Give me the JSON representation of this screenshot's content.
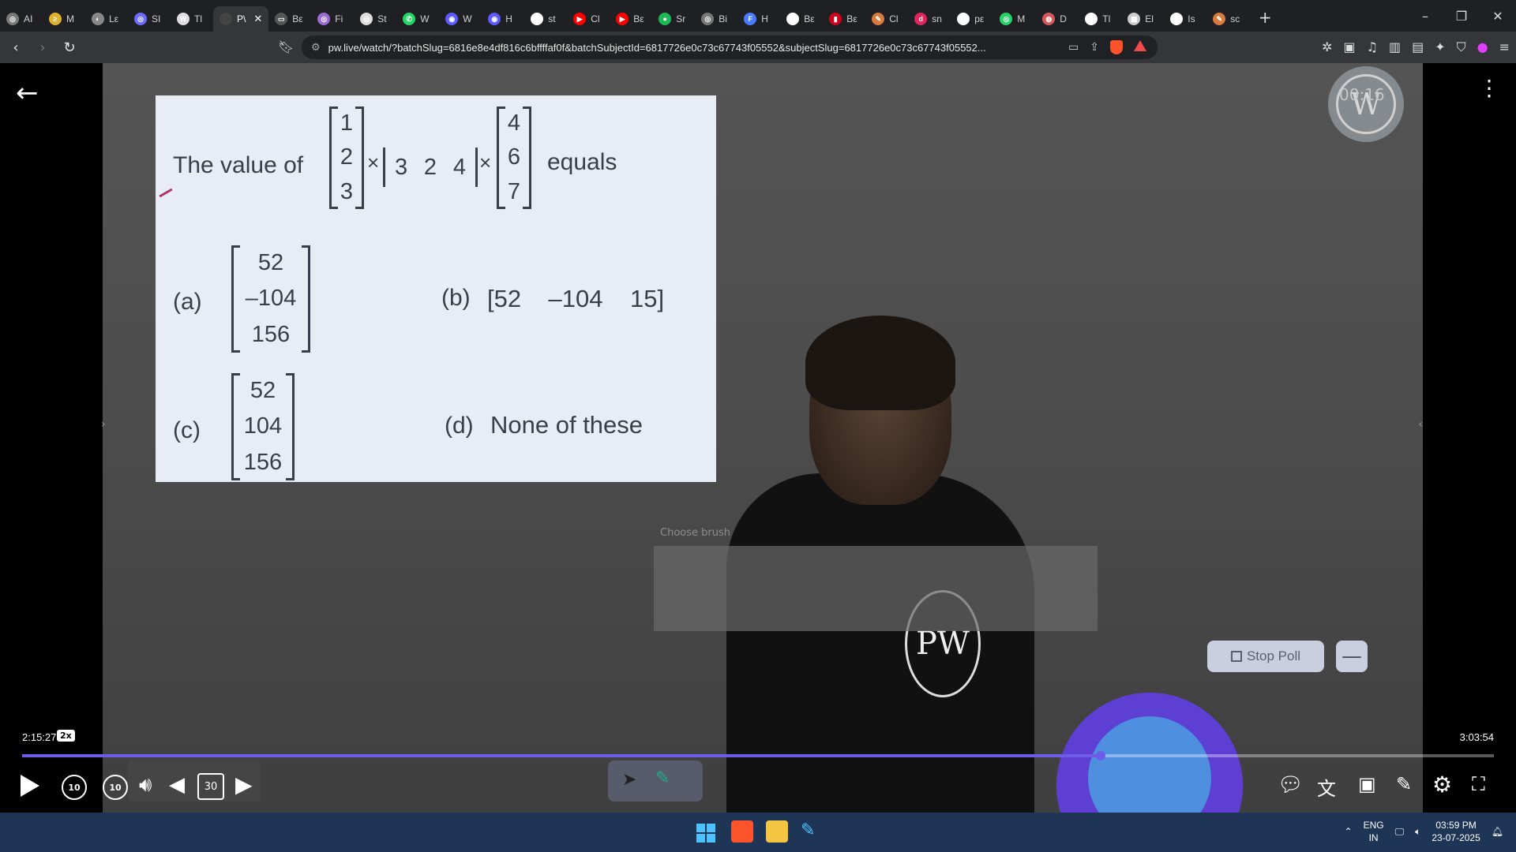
{
  "browser": {
    "tabs": [
      {
        "label": "AI",
        "color": "#7a7a7a",
        "glyph": "◎"
      },
      {
        "label": "M",
        "color": "#e0b030",
        "glyph": "≥"
      },
      {
        "label": "Lε",
        "color": "#888",
        "glyph": "◐"
      },
      {
        "label": "SI",
        "color": "#6b6bff",
        "glyph": "◎"
      },
      {
        "label": "Tl",
        "color": "#ddd",
        "glyph": "W"
      },
      {
        "label": "P\\",
        "color": "#444",
        "glyph": "",
        "active": true
      },
      {
        "label": "Bε",
        "color": "#555",
        "glyph": "▭"
      },
      {
        "label": "Fi",
        "color": "#9b6bd6",
        "glyph": "◎"
      },
      {
        "label": "St",
        "color": "#ddd",
        "glyph": "◎"
      },
      {
        "label": "W",
        "color": "#25d366",
        "glyph": "✆"
      },
      {
        "label": "W",
        "color": "#5b5bff",
        "glyph": "◉"
      },
      {
        "label": "H",
        "color": "#5b5bff",
        "glyph": "◉"
      },
      {
        "label": "st",
        "color": "#fff",
        "glyph": "G"
      },
      {
        "label": "Cl",
        "color": "#ff0000",
        "glyph": "▶"
      },
      {
        "label": "Bε",
        "color": "#ff0000",
        "glyph": "▶"
      },
      {
        "label": "Sr",
        "color": "#1db954",
        "glyph": "●"
      },
      {
        "label": "Bi",
        "color": "#777",
        "glyph": "◎"
      },
      {
        "label": "H",
        "color": "#4a7bff",
        "glyph": "F"
      },
      {
        "label": "Bε",
        "color": "#fff",
        "glyph": "G"
      },
      {
        "label": "Bε",
        "color": "#d0021b",
        "glyph": "▮"
      },
      {
        "label": "Cl",
        "color": "#d97a3a",
        "glyph": "✎"
      },
      {
        "label": "sn",
        "color": "#e0245e",
        "glyph": "d"
      },
      {
        "label": "pε",
        "color": "#fff",
        "glyph": "G"
      },
      {
        "label": "M",
        "color": "#25d366",
        "glyph": "◎"
      },
      {
        "label": "D",
        "color": "#d45a5a",
        "glyph": "◍"
      },
      {
        "label": "Tl",
        "color": "#fff",
        "glyph": "G"
      },
      {
        "label": "El",
        "color": "#ccc",
        "glyph": "▦"
      },
      {
        "label": "Is",
        "color": "#fff",
        "glyph": "G"
      },
      {
        "label": "sc",
        "color": "#d97a3a",
        "glyph": "✎"
      }
    ],
    "url": "pw.live/watch/?batchSlug=6816e8e4df816c6bffffaf0f&batchSubjectId=6817726e0c73c67743f05552&subjectSlug=6817726e0c73c67743f05552..."
  },
  "slide": {
    "q_prefix": "The value of",
    "q_suffix": "equals",
    "col_a": [
      "1",
      "2",
      "3"
    ],
    "row_b": [
      "3",
      "2",
      "4"
    ],
    "col_c": [
      "4",
      "6",
      "7"
    ],
    "times": "×",
    "options": {
      "a_label": "(a)",
      "a_vals": [
        "52",
        "–104",
        "156"
      ],
      "b_label": "(b)",
      "b_text": "[52    –104    15]",
      "c_label": "(c)",
      "c_vals": [
        "52",
        "104",
        "156"
      ],
      "d_label": "(d)",
      "d_text": "None of these"
    }
  },
  "overlay": {
    "watermark_time": "00:16",
    "brush_title": "Choose brush",
    "stop_poll": "Stop Poll",
    "minus": "—"
  },
  "player": {
    "time_current": "2:15:27",
    "speed": "2x",
    "time_total": "3:03:54",
    "progress_fraction": 0.733,
    "skip_back": "10",
    "skip_fwd": "10",
    "thirty": "30"
  },
  "taskbar": {
    "lang_top": "ENG",
    "lang_bottom": "IN",
    "time": "03:59 PM",
    "date": "23-07-2025"
  },
  "colors": {
    "accent": "#6c5ce7",
    "slide_bg": "#e7ecf5",
    "poll_btn": "#c9cfde"
  }
}
